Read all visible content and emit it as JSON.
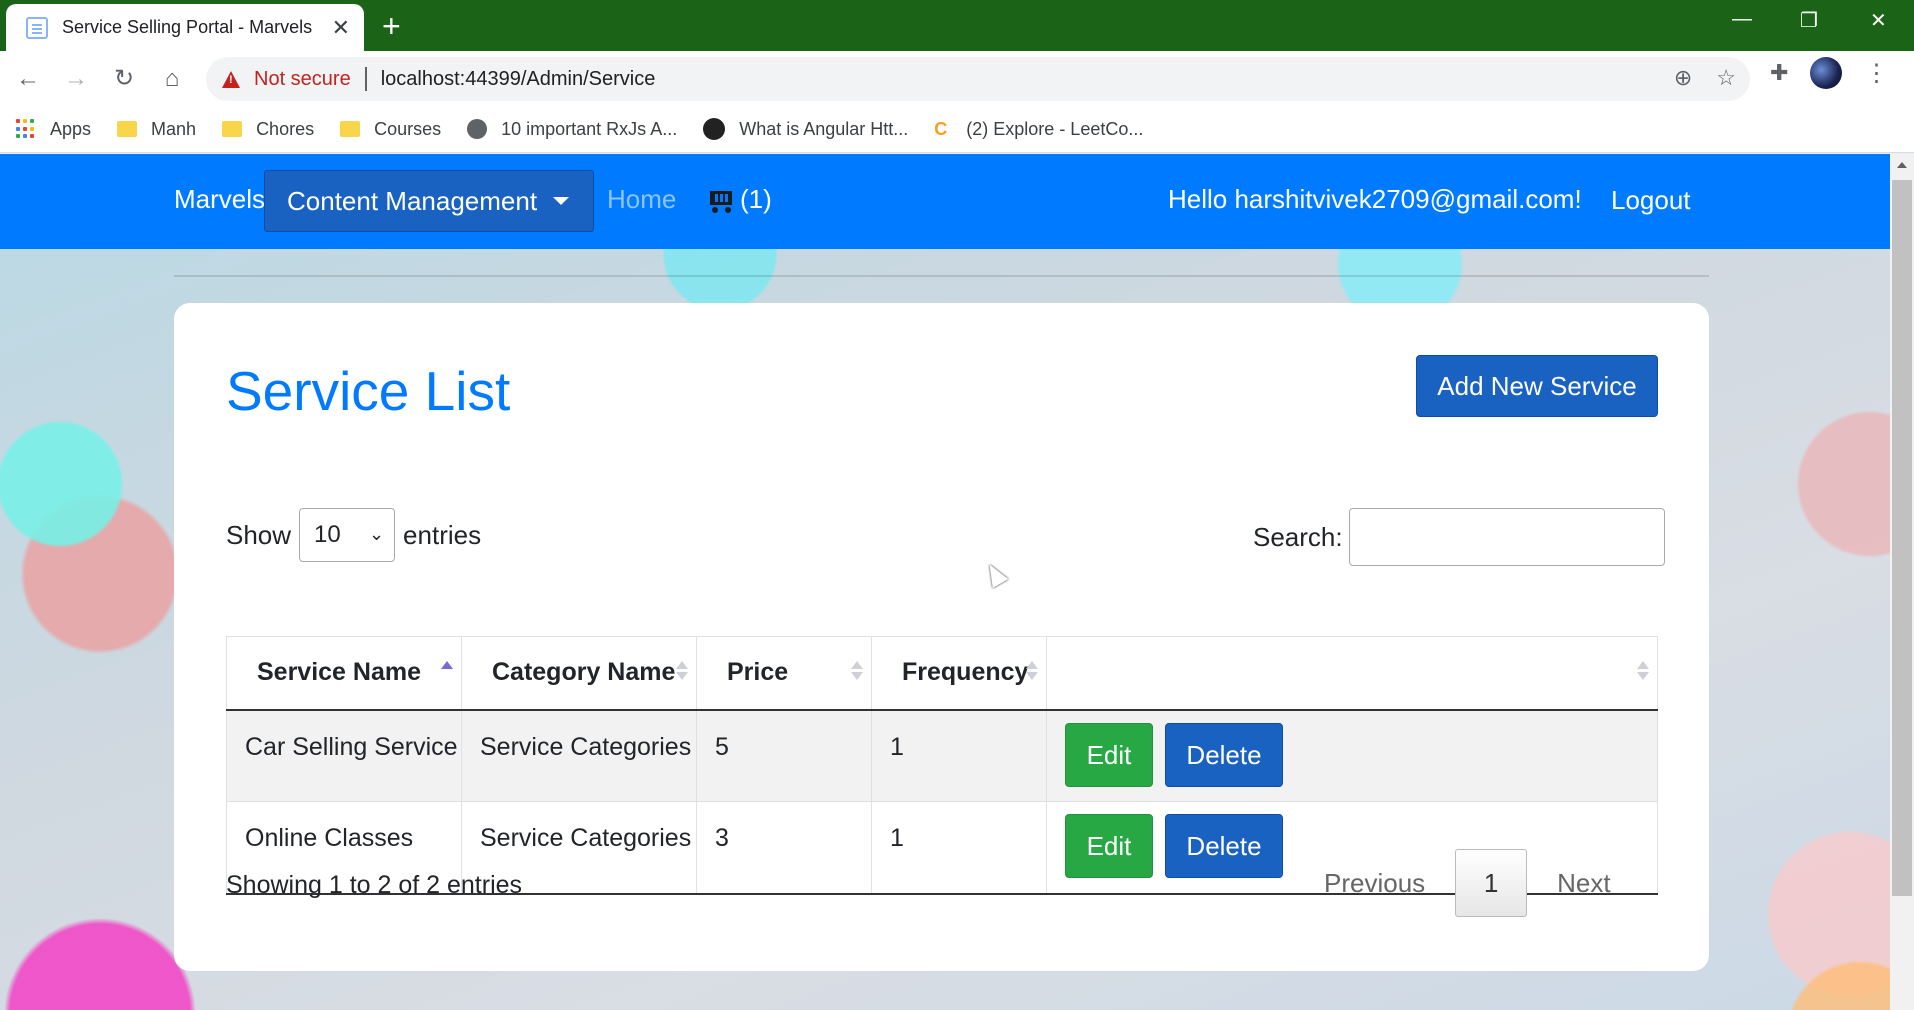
{
  "browser": {
    "tab_title": "Service Selling Portal - Marvels",
    "tab_close": "✕",
    "new_tab": "+",
    "security_label": "Not secure",
    "url": "localhost:44399/Admin/Service",
    "window_controls": {
      "minimize": "—",
      "restore": "❐",
      "close": "✕"
    },
    "nav_icons": {
      "back": "←",
      "forward": "→",
      "reload": "↻",
      "home": "⌂"
    },
    "omnibox_icons": {
      "zoom": "⊕",
      "star": "☆"
    },
    "toolbar_icons": {
      "extensions": "✚",
      "menu": "⋮"
    },
    "bookmarks": [
      {
        "label": "Apps",
        "icon": "apps-icon"
      },
      {
        "label": "Manh",
        "icon": "folder-icon"
      },
      {
        "label": "Chores",
        "icon": "folder-icon"
      },
      {
        "label": "Courses",
        "icon": "folder-icon"
      },
      {
        "label": "10 important RxJs A...",
        "icon": "globe-icon"
      },
      {
        "label": "What is Angular Htt...",
        "icon": "site-icon"
      },
      {
        "label": "(2) Explore - LeetCo...",
        "icon": "leetcode-icon"
      }
    ]
  },
  "navbar": {
    "brand": "Marvels",
    "dropdown_label": "Content Management",
    "home": "Home",
    "cart_count": "(1)",
    "greeting": "Hello harshitvivek2709@gmail.com!",
    "logout": "Logout",
    "color": "#007bff"
  },
  "page": {
    "title": "Service List",
    "add_button": "Add New Service",
    "length": {
      "prefix": "Show",
      "value": "10",
      "suffix": "entries",
      "chevron": "⌄"
    },
    "search": {
      "label": "Search:",
      "value": ""
    }
  },
  "table": {
    "columns": [
      "Service Name",
      "Category Name",
      "Price",
      "Frequency",
      ""
    ],
    "sorted_column": "Service Name",
    "rows": [
      {
        "service": "Car Selling Service",
        "category": "Service Categories",
        "price": "5",
        "frequency": "1"
      },
      {
        "service": "Online Classes",
        "category": "Service Categories",
        "price": "3",
        "frequency": "1"
      }
    ],
    "edit_label": "Edit",
    "delete_label": "Delete"
  },
  "footer": {
    "info": "Showing 1 to 2 of 2 entries",
    "previous": "Previous",
    "current_page": "1",
    "next": "Next"
  },
  "colors": {
    "primary": "#007bff",
    "button_blue": "#1a62c2",
    "success": "#28a745",
    "chrome_frame": "#1b6316",
    "danger_text": "#c5221f"
  }
}
